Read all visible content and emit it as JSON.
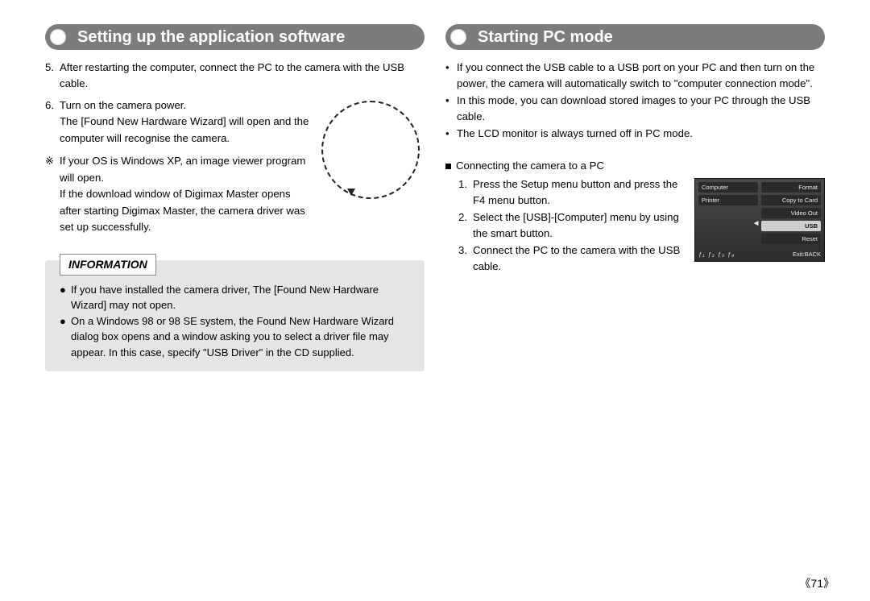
{
  "left": {
    "title": "Setting up the application software",
    "step5_num": "5.",
    "step5": "After restarting the computer, connect the PC to the camera with the USB cable.",
    "step6_num": "6.",
    "step6_a": "Turn on the camera power.",
    "step6_b": "The [Found New Hardware Wizard] will open and the computer will recognise the camera.",
    "note_sym": "※",
    "note_a": "If your OS is Windows XP, an image viewer program will open.",
    "note_b": "If the download window of Digimax Master opens after starting Digimax Master, the camera driver was set up successfully.",
    "info_label": "INFORMATION",
    "info_bul": "●",
    "info_1": "If you have installed the camera driver, The [Found New Hardware Wizard] may not open.",
    "info_2": "On a Windows 98 or 98 SE system, the Found New Hardware Wizard dialog box opens and a window asking you to select a driver file may appear. In this case, specify \"USB Driver\" in the CD supplied."
  },
  "right": {
    "title": "Starting PC mode",
    "bul_sym": "•",
    "p1": "If you connect the USB cable to a USB port on your PC and then turn on the power, the camera will automatically switch to \"computer connection mode\".",
    "p2": "In this mode, you can download stored images to your PC through the USB cable.",
    "p3": "The LCD monitor is always turned off in PC mode.",
    "sub_title": "Connecting the camera to a PC",
    "s1_num": "1.",
    "s1": "Press the Setup menu button and press the F4 menu button.",
    "s2_num": "2.",
    "s2": "Select the [USB]-[Computer] menu by using the smart button.",
    "s3_num": "3.",
    "s3": "Connect the PC to the camera with the USB cable.",
    "screen": {
      "left": [
        "Computer",
        "Printer"
      ],
      "right": [
        "Format",
        "Copy to Card",
        "Video Out",
        "USB",
        "Reset"
      ],
      "foot_left": "ƒ₁ ƒ₂ ƒ₃ ƒ₄",
      "foot_right": "Exit:BACK"
    }
  },
  "page_num": "《71》"
}
